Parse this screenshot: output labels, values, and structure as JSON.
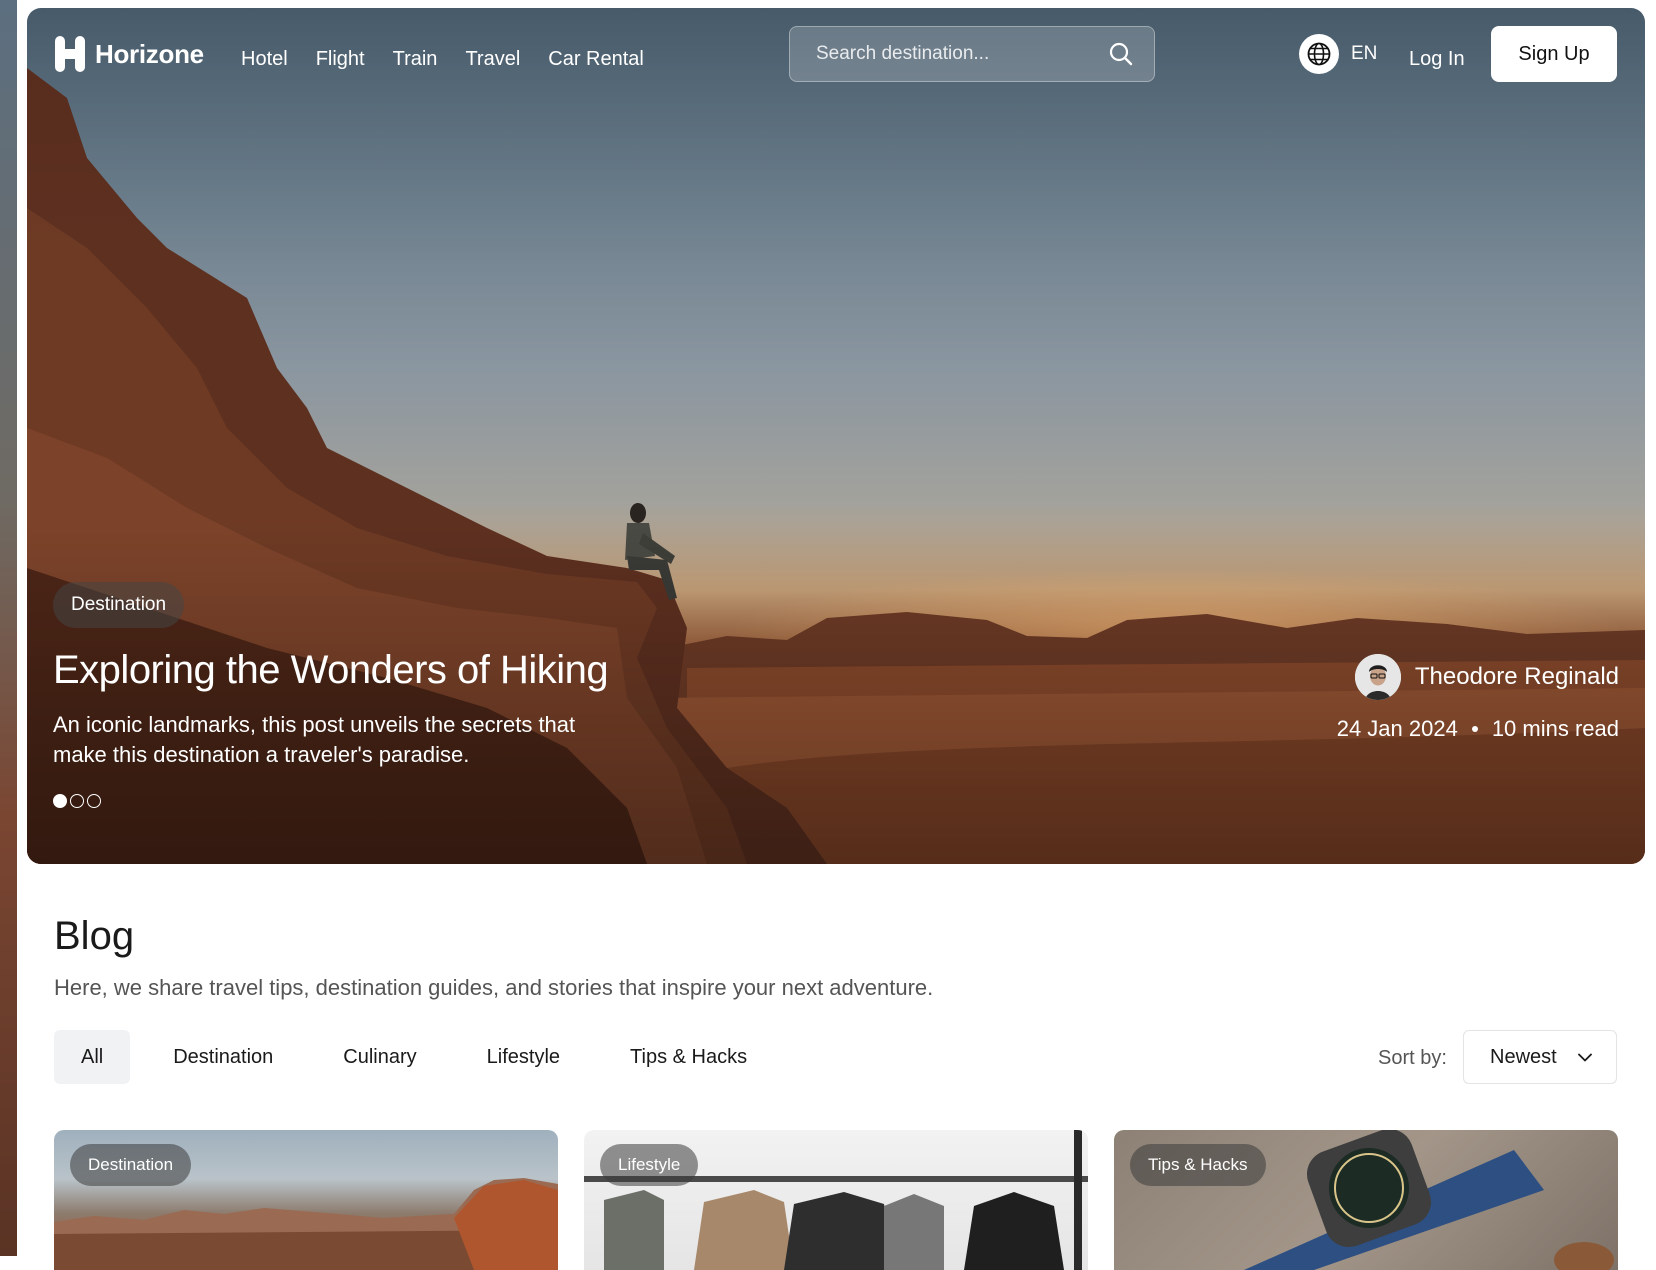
{
  "brand": {
    "name": "Horizone"
  },
  "nav": {
    "links": [
      "Hotel",
      "Flight",
      "Train",
      "Travel",
      "Car Rental"
    ],
    "search_placeholder": "Search destination...",
    "language": "EN",
    "login_label": "Log In",
    "signup_label": "Sign Up"
  },
  "hero": {
    "category": "Destination",
    "title": "Exploring the Wonders of Hiking",
    "description": "An iconic landmarks, this post unveils the secrets that make this destination a traveler's paradise.",
    "author": "Theodore Reginald",
    "date": "24 Jan 2024",
    "read_time": "10 mins read",
    "slides_total": 3,
    "active_slide": 1
  },
  "blog": {
    "title": "Blog",
    "subtitle": "Here, we share travel tips, destination guides, and stories that inspire your next adventure.",
    "tabs": [
      "All",
      "Destination",
      "Culinary",
      "Lifestyle",
      "Tips & Hacks"
    ],
    "active_tab": "All",
    "sort_label": "Sort by:",
    "sort_value": "Newest"
  },
  "cards": [
    {
      "category": "Destination"
    },
    {
      "category": "Lifestyle"
    },
    {
      "category": "Tips & Hacks"
    }
  ],
  "colors": {
    "primary_text": "#1a1a1a",
    "muted_text": "#555555",
    "tab_active_bg": "#f1f2f3"
  }
}
